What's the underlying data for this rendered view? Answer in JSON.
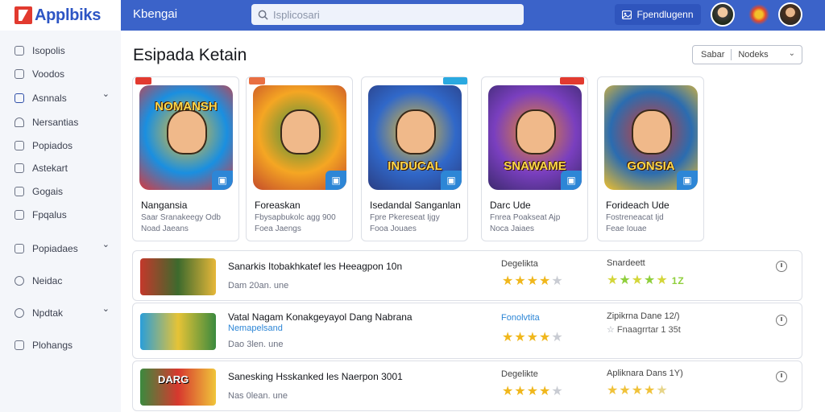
{
  "app": {
    "logo_text": "Applbiks",
    "top_title": "Kbengai",
    "search_placeholder": "Isplicosari",
    "top_button_label": "Fpendlugenn"
  },
  "sidebar": {
    "items": [
      {
        "label": "Isopolis",
        "icon": "home-icon",
        "chevron": false
      },
      {
        "label": "Voodos",
        "icon": "video-icon",
        "chevron": false
      },
      {
        "label": "Asnnals",
        "icon": "folder-icon",
        "chevron": true
      },
      {
        "label": "Nersantias",
        "icon": "user-icon",
        "chevron": false
      },
      {
        "label": "Popiados",
        "icon": "download-icon",
        "chevron": false
      },
      {
        "label": "Astekart",
        "icon": "chart-icon",
        "chevron": false
      },
      {
        "label": "Gogais",
        "icon": "game-icon",
        "chevron": false
      },
      {
        "label": "Fpqalus",
        "icon": "settings-icon",
        "chevron": false
      },
      {
        "label": "Popiadaes",
        "icon": "list-icon",
        "chevron": true
      },
      {
        "label": "Neidac",
        "icon": "clock-icon",
        "chevron": false
      },
      {
        "label": "Npdtak",
        "icon": "globe-icon",
        "chevron": true
      },
      {
        "label": "Plohangs",
        "icon": "doc-icon",
        "chevron": false
      }
    ]
  },
  "main": {
    "page_title": "Esipada Ketain",
    "sort": {
      "label": "Sabar",
      "value": "Nodeks"
    }
  },
  "cards": [
    {
      "title": "Nangansia",
      "line1": "Saar Sranakeegy Odb",
      "line2": "Noad Jaeans",
      "tag_color": "#e23a2f",
      "art_text": "NOMANSH",
      "colors": [
        "#1a8fe0",
        "#f3c12a",
        "#d8393d"
      ]
    },
    {
      "title": "Foreaskan",
      "line1": "Fbysapbukolc agg 900",
      "line2": "Foea Jaengs",
      "tag_color": "#e96f42",
      "art_text": "",
      "colors": [
        "#f5a623",
        "#3b8f3f",
        "#c44b2a"
      ]
    },
    {
      "title": "Isedandal Sanganlan",
      "line1": "Fpre Pkereseat Ijgy",
      "line2": "Fooa Jouaes",
      "tag_color": "#2aa9e0",
      "art_text": "INDUCAL",
      "colors": [
        "#3068c9",
        "#f3c12a",
        "#2b3e83"
      ]
    },
    {
      "title": "Darc Ude",
      "line1": "Fnrea Poakseat Ajp",
      "line2": "Noca Jaiaes",
      "tag_color": "#e23a2f",
      "art_text": "SNAWAME",
      "colors": [
        "#7a3fbf",
        "#f08a24",
        "#3c2a6e"
      ]
    },
    {
      "title": "Forideach Ude",
      "line1": "Fostreneacat Ijd",
      "line2": "Feae Iouae",
      "tag_color": "",
      "art_text": "GONSIA",
      "colors": [
        "#2b6cb0",
        "#d8392f",
        "#f3c12a"
      ]
    }
  ],
  "rows": [
    {
      "title": "Sanarkis Itobakhkatef les Heeagpon 10n",
      "link": "",
      "sub": "Dam 20an. une",
      "label": "Degelikta",
      "stars_gold": 4,
      "stars_style": "gold",
      "label2": "Snardeett",
      "sub2": "",
      "stars2": 5,
      "stars2_style": "green",
      "stars2_suffix": "1Z",
      "thumb_colors": [
        "#c4382b",
        "#3d6a2d",
        "#e6b739"
      ]
    },
    {
      "title": "Vatal Nagam Konakgeyayol Dang Nabrana",
      "link": "Nemapelsand",
      "sub": "Dao 3len. une",
      "label": "Fonolvtita",
      "stars_gold": 4,
      "stars_style": "gold",
      "label2": "Zipikrna Dane 12/)",
      "sub2": "Fnaagrrtar 1 35t",
      "stars2": 0,
      "stars2_style": "gold",
      "stars2_suffix": "",
      "thumb_colors": [
        "#2a9ed9",
        "#e6c336",
        "#3b8a3e"
      ]
    },
    {
      "title": "Sanesking Hsskanked les Naerpon 3001",
      "link": "",
      "sub": "Nas 0lean. une",
      "label": "Degelikte",
      "stars_gold": 4,
      "stars_style": "gold",
      "label2": "Apliknara Dans 1Y)",
      "sub2": "",
      "stars2": 5,
      "stars2_style": "gold",
      "stars2_suffix": "",
      "thumb_colors": [
        "#3b8a3e",
        "#d7382e",
        "#f0c53a"
      ]
    }
  ],
  "rows_text": {
    "thumb_text_3": "DARG"
  }
}
